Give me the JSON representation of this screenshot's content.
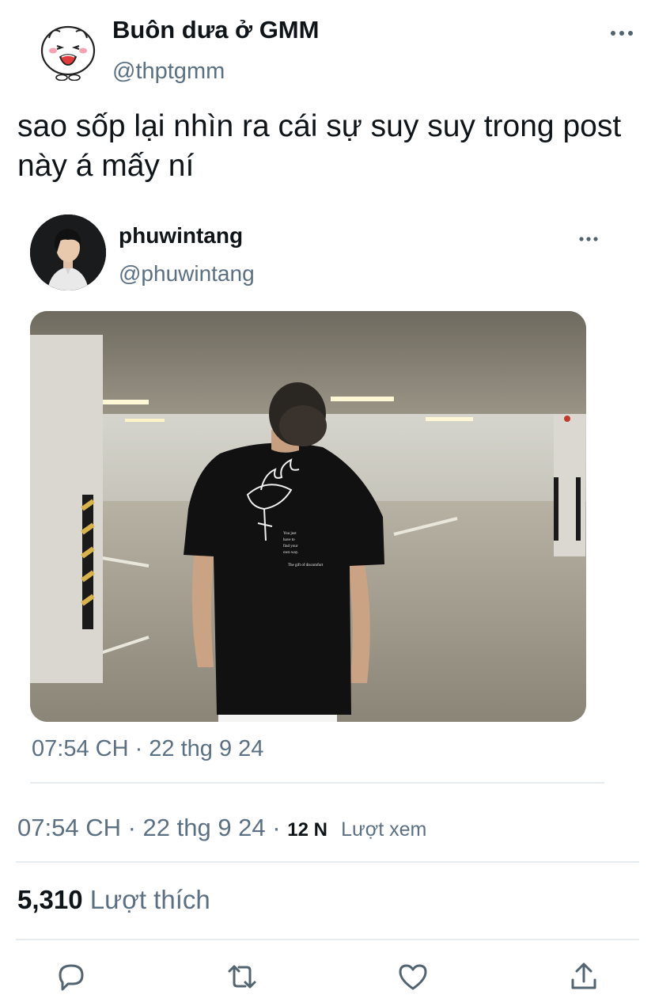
{
  "tweet": {
    "display_name": "Buôn dưa ở GMM",
    "handle": "@thptgmm",
    "text": "sao sốp lại nhìn ra cái sự suy suy trong post này á mấy ní",
    "avatar_icon": "mochi-bunny-avatar"
  },
  "quoted_tweet": {
    "display_name": "phuwintang",
    "handle": "@phuwintang",
    "timestamp": "07:54 CH · 22 thg 9 24",
    "photo": {
      "shirt_text_lines": [
        "You just",
        "have to",
        "find your",
        "own way.",
        "The gift of discomfort"
      ]
    }
  },
  "meta": {
    "timestamp": "07:54 CH · 22 thg 9 24",
    "separator": " · ",
    "views_count": "12 N",
    "views_label": "Lượt xem"
  },
  "likes": {
    "count": "5,310",
    "label": "Lượt thích"
  },
  "colors": {
    "text_primary": "#0f1419",
    "text_secondary": "#5b7083",
    "divider": "#e6ecf0",
    "icon": "#536471"
  },
  "actions": [
    "reply-icon",
    "retweet-icon",
    "like-icon",
    "share-icon"
  ]
}
